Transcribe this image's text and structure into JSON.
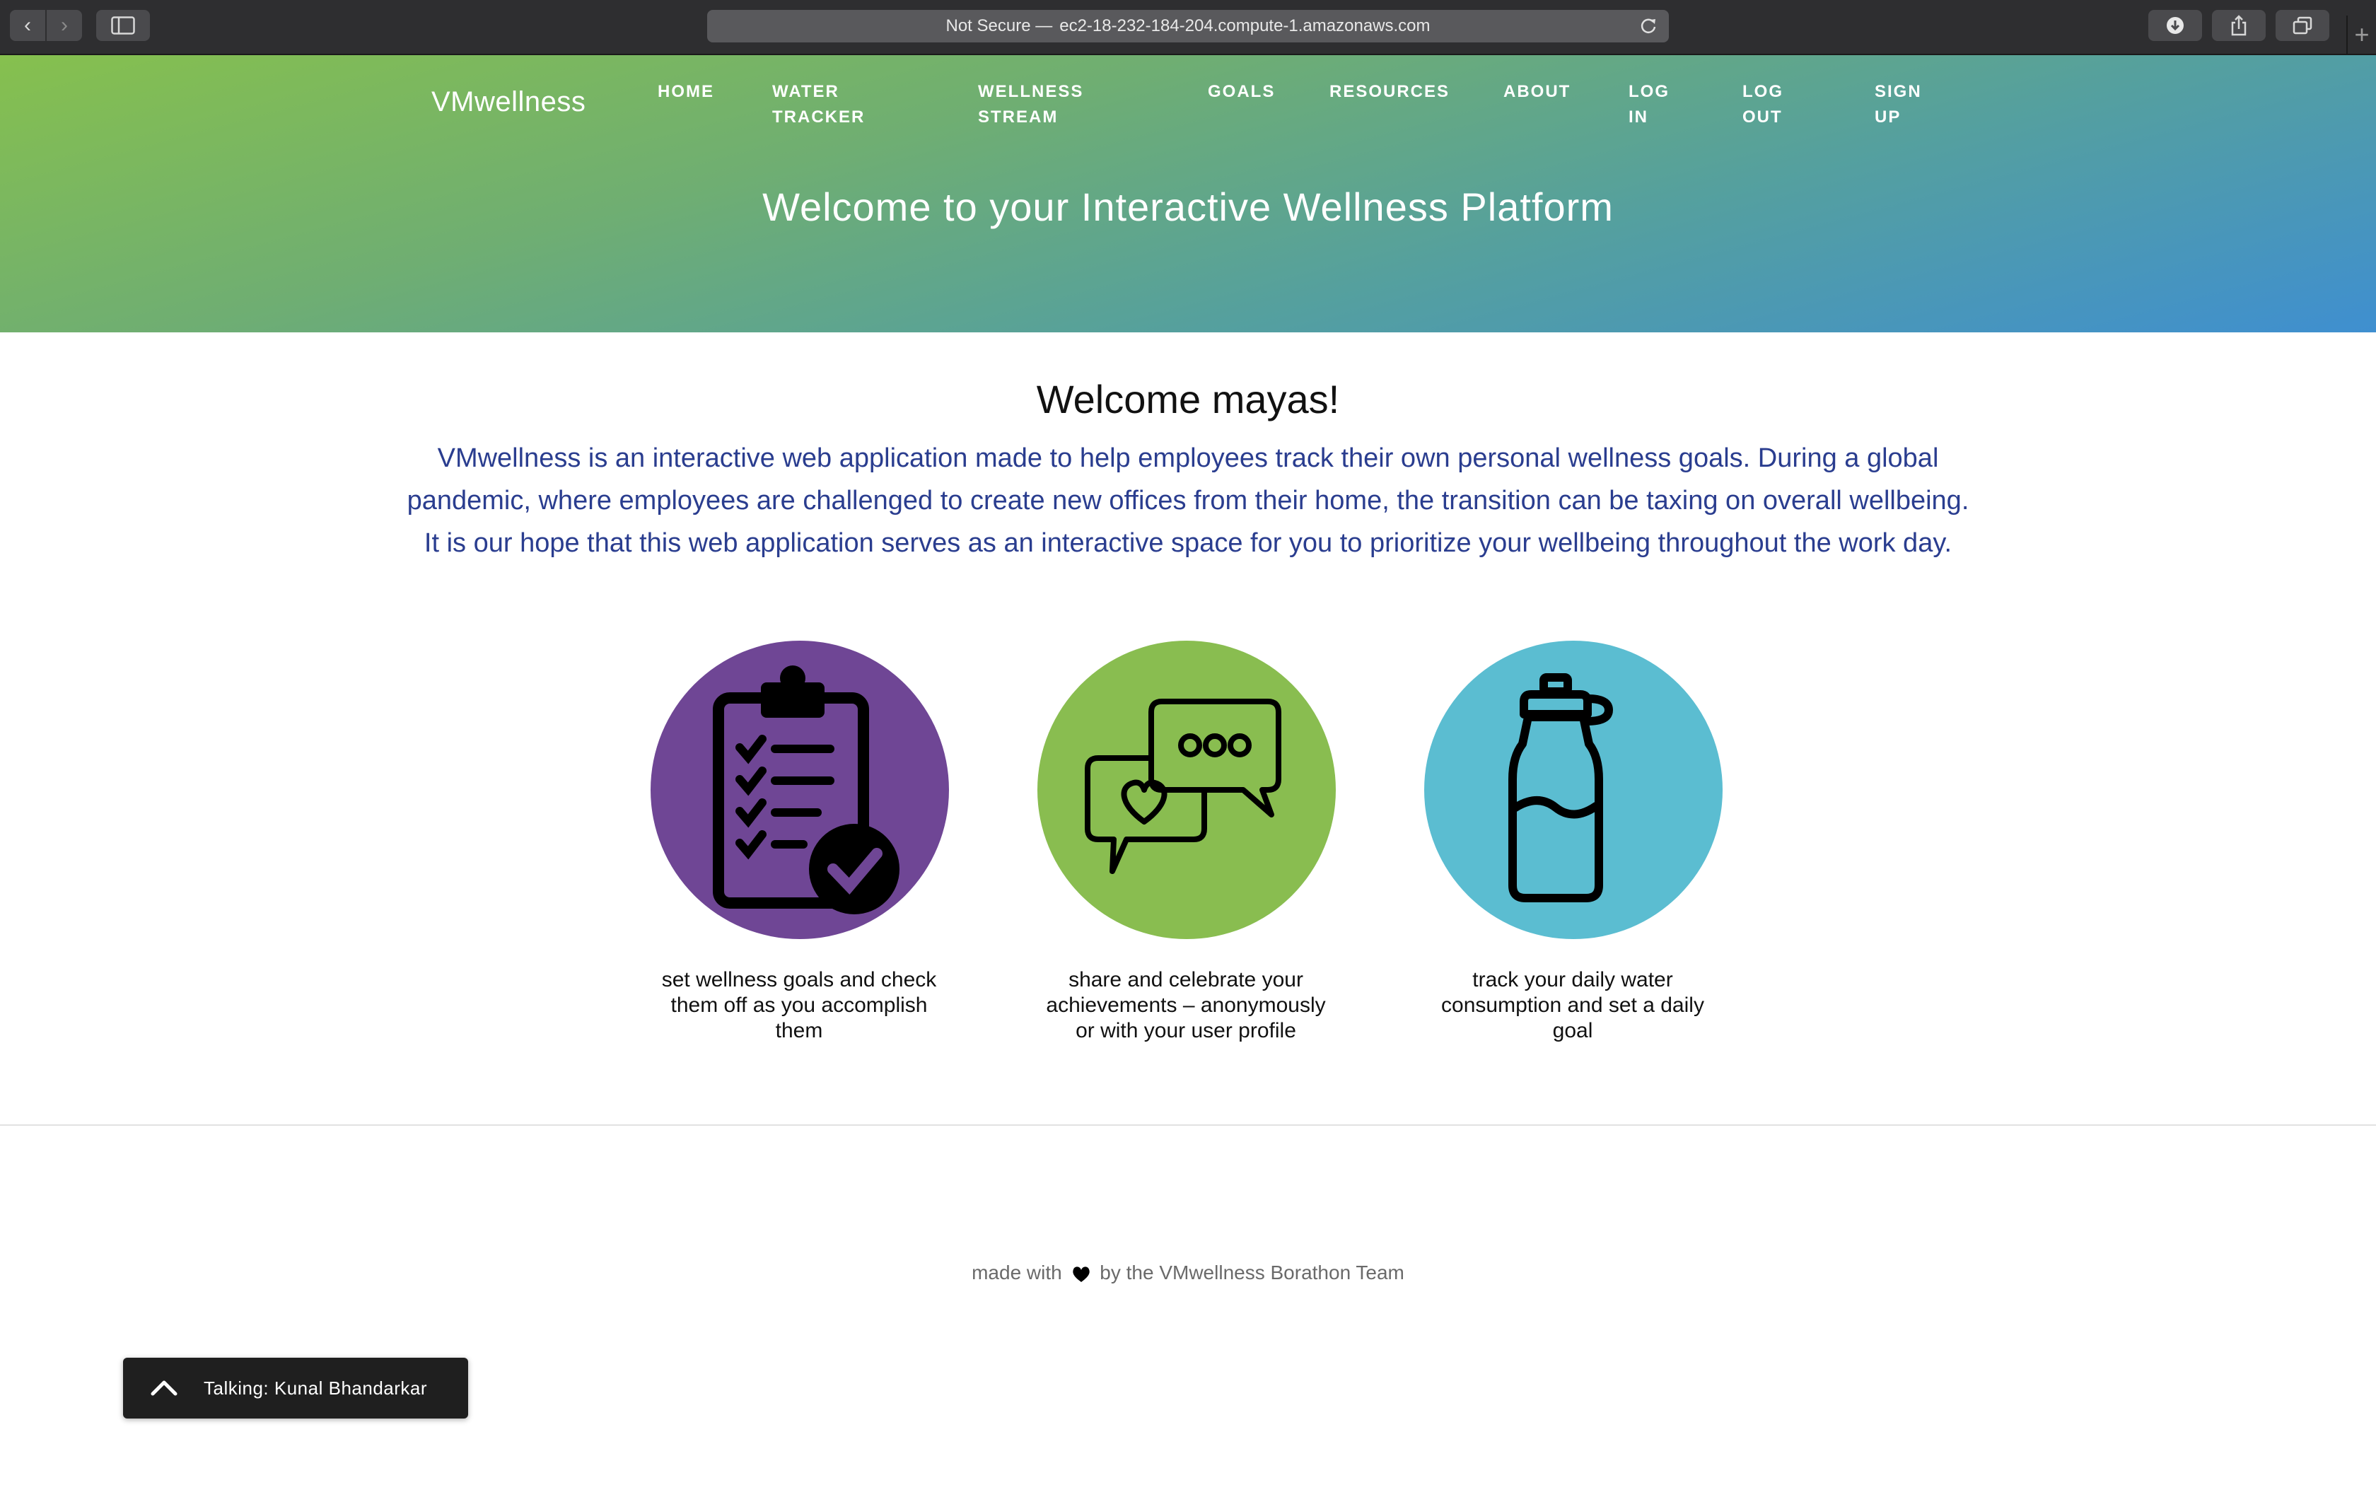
{
  "browser": {
    "url_security": "Not Secure —",
    "url": "ec2-18-232-184-204.compute-1.amazonaws.com"
  },
  "site": {
    "brand": "VMwellness",
    "nav": [
      {
        "label": "HOME"
      },
      {
        "label": "WATER\nTRACKER"
      },
      {
        "label": "WELLNESS\nSTREAM"
      },
      {
        "label": "GOALS"
      },
      {
        "label": "RESOURCES"
      },
      {
        "label": "ABOUT"
      },
      {
        "label": "LOG\nIN"
      },
      {
        "label": "LOG\nOUT"
      },
      {
        "label": "SIGN\nUP"
      }
    ],
    "hero_title": "Welcome to your Interactive Wellness Platform"
  },
  "main": {
    "welcome": "Welcome mayas!",
    "intro": "VMwellness is an interactive web application made to help employees track their own personal wellness goals. During a global pandemic, where employees are challenged to create new offices from their home, the transition can be taxing on overall wellbeing. It is our hope that this web application serves as an interactive space for you to prioritize your wellbeing throughout the work day.",
    "features": [
      {
        "icon": "clipboard-check-icon",
        "color": "#6f4695",
        "text": "set wellness goals and check them off as you accomplish them"
      },
      {
        "icon": "chat-bubbles-heart-icon",
        "color": "#89bd50",
        "text": "share and celebrate your achievements – anonymously or with your user profile"
      },
      {
        "icon": "water-bottle-icon",
        "color": "#5bbdd1",
        "text": "track your daily water consumption and set a daily goal"
      }
    ]
  },
  "footer": {
    "before_heart": "made with",
    "after_heart": "by the VMwellness Borathon Team"
  },
  "talk_bar": {
    "label": "Talking: Kunal Bhandarkar"
  }
}
